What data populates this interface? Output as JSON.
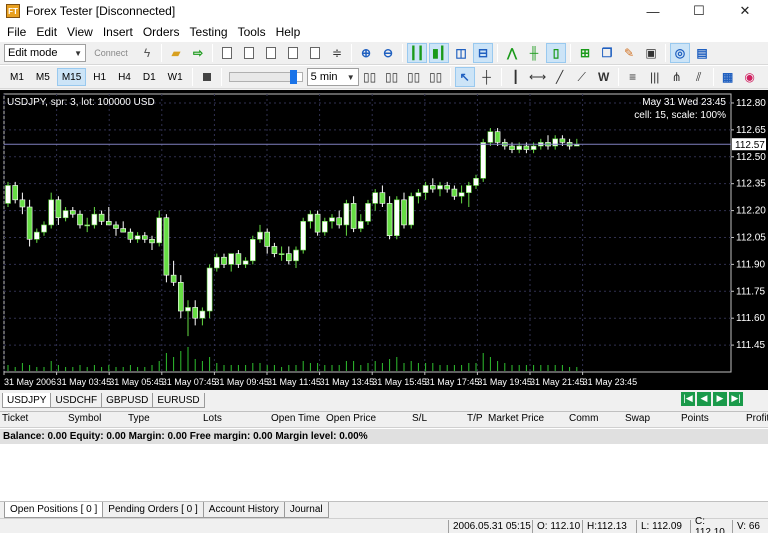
{
  "window": {
    "title": "Forex Tester [Disconnected]",
    "icon_text": "FT",
    "minimize": "—",
    "maximize": "☐",
    "close": "✕"
  },
  "menu": [
    "File",
    "Edit",
    "View",
    "Insert",
    "Orders",
    "Testing",
    "Tools",
    "Help"
  ],
  "toolbar1": {
    "mode_value": "Edit mode",
    "connect_label": "Connect"
  },
  "toolbar2": {
    "timeframes": [
      "M1",
      "M5",
      "M15",
      "H1",
      "H4",
      "D1",
      "W1"
    ],
    "active_timeframe": "M15",
    "speed_level": 0.9,
    "step_value": "5 min"
  },
  "chart": {
    "symbol_info": "USDJPY, spr: 3, lot: 100000 USD",
    "datetime": "May 31 Wed 23:45",
    "cell_info": "cell: 15, scale: 100%",
    "current_price": "112.57",
    "bg_color": "#000000",
    "bull_color": "#66dd44",
    "bear_color": "#ffffff"
  },
  "chart_data": {
    "type": "candlestick",
    "ylim": [
      111.3,
      112.85
    ],
    "price_ticks": [
      "112.80",
      "112.65",
      "112.50",
      "112.35",
      "112.20",
      "112.05",
      "111.90",
      "111.75",
      "111.60",
      "111.45"
    ],
    "time_ticks": [
      "31 May 2006",
      "31 May 03:45",
      "31 May 05:45",
      "31 May 07:45",
      "31 May 09:45",
      "31 May 11:45",
      "31 May 13:45",
      "31 May 15:45",
      "31 May 17:45",
      "31 May 19:45",
      "31 May 21:45",
      "31 May 23:45"
    ],
    "current_price": 112.57,
    "candles": [
      [
        112.24,
        112.36,
        112.22,
        112.34
      ],
      [
        112.34,
        112.36,
        112.24,
        112.26
      ],
      [
        112.26,
        112.3,
        112.18,
        112.22
      ],
      [
        112.22,
        112.26,
        112.0,
        112.04
      ],
      [
        112.04,
        112.1,
        112.02,
        112.08
      ],
      [
        112.08,
        112.14,
        112.06,
        112.12
      ],
      [
        112.12,
        112.3,
        112.1,
        112.26
      ],
      [
        112.26,
        112.28,
        112.12,
        112.16
      ],
      [
        112.16,
        112.22,
        112.14,
        112.2
      ],
      [
        112.2,
        112.22,
        112.16,
        112.18
      ],
      [
        112.18,
        112.2,
        112.1,
        112.12
      ],
      [
        112.12,
        112.16,
        112.08,
        112.12
      ],
      [
        112.12,
        112.22,
        112.1,
        112.18
      ],
      [
        112.18,
        112.2,
        112.12,
        112.14
      ],
      [
        112.14,
        112.22,
        112.12,
        112.12
      ],
      [
        112.12,
        112.14,
        112.06,
        112.1
      ],
      [
        112.1,
        112.14,
        112.08,
        112.08
      ],
      [
        112.08,
        112.1,
        112.02,
        112.04
      ],
      [
        112.04,
        112.08,
        112.02,
        112.06
      ],
      [
        112.06,
        112.08,
        112.02,
        112.04
      ],
      [
        112.04,
        112.06,
        111.98,
        112.02
      ],
      [
        112.02,
        112.2,
        112.0,
        112.16
      ],
      [
        112.16,
        112.18,
        111.8,
        111.84
      ],
      [
        111.84,
        111.92,
        111.78,
        111.8
      ],
      [
        111.8,
        111.84,
        111.6,
        111.64
      ],
      [
        111.64,
        111.7,
        111.5,
        111.66
      ],
      [
        111.66,
        111.7,
        111.56,
        111.6
      ],
      [
        111.6,
        111.66,
        111.56,
        111.64
      ],
      [
        111.64,
        111.9,
        111.6,
        111.88
      ],
      [
        111.88,
        111.96,
        111.86,
        111.94
      ],
      [
        111.94,
        111.96,
        111.88,
        111.9
      ],
      [
        111.9,
        111.96,
        111.86,
        111.96
      ],
      [
        111.96,
        111.98,
        111.88,
        111.9
      ],
      [
        111.9,
        111.94,
        111.88,
        111.92
      ],
      [
        111.92,
        112.06,
        111.9,
        112.04
      ],
      [
        112.04,
        112.12,
        112.02,
        112.08
      ],
      [
        112.08,
        112.1,
        111.96,
        112.0
      ],
      [
        112.0,
        112.02,
        111.94,
        111.96
      ],
      [
        111.96,
        112.0,
        111.92,
        111.96
      ],
      [
        111.96,
        112.0,
        111.9,
        111.92
      ],
      [
        111.92,
        112.0,
        111.88,
        111.98
      ],
      [
        111.98,
        112.16,
        111.96,
        112.14
      ],
      [
        112.14,
        112.2,
        112.1,
        112.18
      ],
      [
        112.18,
        112.2,
        112.06,
        112.08
      ],
      [
        112.08,
        112.16,
        112.06,
        112.14
      ],
      [
        112.14,
        112.18,
        112.1,
        112.16
      ],
      [
        112.16,
        112.2,
        112.1,
        112.12
      ],
      [
        112.12,
        112.26,
        112.06,
        112.24
      ],
      [
        112.24,
        112.28,
        112.08,
        112.1
      ],
      [
        112.1,
        112.18,
        112.08,
        112.14
      ],
      [
        112.14,
        112.26,
        112.12,
        112.24
      ],
      [
        112.24,
        112.32,
        112.2,
        112.3
      ],
      [
        112.3,
        112.34,
        112.22,
        112.24
      ],
      [
        112.24,
        112.28,
        112.04,
        112.06
      ],
      [
        112.06,
        112.28,
        112.04,
        112.26
      ],
      [
        112.26,
        112.3,
        112.1,
        112.12
      ],
      [
        112.12,
        112.3,
        112.1,
        112.28
      ],
      [
        112.28,
        112.32,
        112.24,
        112.3
      ],
      [
        112.3,
        112.36,
        112.26,
        112.34
      ],
      [
        112.34,
        112.38,
        112.3,
        112.32
      ],
      [
        112.32,
        112.36,
        112.28,
        112.34
      ],
      [
        112.34,
        112.36,
        112.3,
        112.32
      ],
      [
        112.32,
        112.34,
        112.26,
        112.28
      ],
      [
        112.28,
        112.34,
        112.24,
        112.3
      ],
      [
        112.3,
        112.36,
        112.22,
        112.34
      ],
      [
        112.34,
        112.4,
        112.32,
        112.38
      ],
      [
        112.38,
        112.6,
        112.36,
        112.58
      ],
      [
        112.58,
        112.66,
        112.56,
        112.64
      ],
      [
        112.64,
        112.66,
        112.56,
        112.58
      ],
      [
        112.58,
        112.6,
        112.54,
        112.56
      ],
      [
        112.56,
        112.58,
        112.52,
        112.54
      ],
      [
        112.54,
        112.58,
        112.52,
        112.56
      ],
      [
        112.56,
        112.58,
        112.52,
        112.54
      ],
      [
        112.54,
        112.58,
        112.52,
        112.56
      ],
      [
        112.56,
        112.6,
        112.54,
        112.58
      ],
      [
        112.58,
        112.62,
        112.54,
        112.56
      ],
      [
        112.56,
        112.62,
        112.54,
        112.6
      ],
      [
        112.6,
        112.62,
        112.56,
        112.58
      ],
      [
        112.58,
        112.6,
        112.54,
        112.56
      ],
      [
        112.56,
        112.6,
        112.56,
        112.57
      ]
    ],
    "volumes": [
      3,
      2,
      4,
      3,
      2,
      2,
      5,
      3,
      2,
      2,
      3,
      2,
      3,
      2,
      3,
      2,
      2,
      3,
      2,
      2,
      3,
      5,
      9,
      7,
      10,
      12,
      6,
      5,
      7,
      4,
      3,
      3,
      3,
      3,
      4,
      4,
      3,
      3,
      2,
      3,
      3,
      5,
      4,
      4,
      3,
      3,
      3,
      5,
      5,
      3,
      4,
      5,
      4,
      6,
      7,
      4,
      5,
      4,
      4,
      4,
      3,
      3,
      3,
      3,
      4,
      4,
      9,
      7,
      5,
      4,
      3,
      3,
      3,
      3,
      3,
      3,
      3,
      3,
      2,
      2
    ]
  },
  "symbol_tabs": [
    "USDJPY",
    "USDCHF",
    "GBPUSD",
    "EURUSD"
  ],
  "active_symbol": "USDJPY",
  "orders_table": {
    "columns": [
      "Ticket",
      "Symbol",
      "Type",
      "Lots",
      "Open Time",
      "Open Price",
      "S/L",
      "T/P",
      "Market Price",
      "Comm",
      "Swap",
      "Points",
      "Profit"
    ],
    "balance_line": "Balance: 0.00 Equity: 0.00 Margin: 0.00 Free margin: 0.00 Margin level: 0.00%"
  },
  "bottom_tabs": [
    "Open Positions [ 0 ]",
    "Pending Orders [ 0 ]",
    "Account History",
    "Journal"
  ],
  "status": {
    "datetime": "2006.05.31 05:15",
    "open": "O: 112.10",
    "high": "H:112.13",
    "low": "L: 112.09",
    "close": "C: 112.10",
    "volume": "V: 66"
  }
}
